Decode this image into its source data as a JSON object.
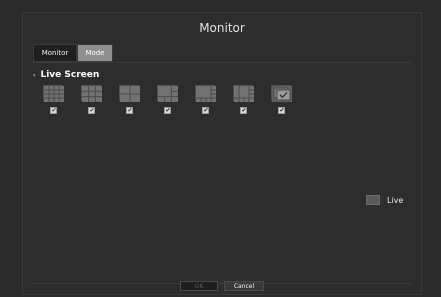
{
  "window": {
    "title": "Monitor"
  },
  "tabs": [
    {
      "label": "Monitor",
      "state": "normal"
    },
    {
      "label": "Mode",
      "state": "selected"
    }
  ],
  "section": {
    "title": "Live Screen"
  },
  "layouts": [
    {
      "icon": "grid-16",
      "checked": true,
      "enabled": false
    },
    {
      "icon": "grid-9",
      "checked": true,
      "enabled": false
    },
    {
      "icon": "grid-4",
      "checked": true,
      "enabled": false
    },
    {
      "icon": "grid-6a",
      "checked": true,
      "enabled": true
    },
    {
      "icon": "grid-6b",
      "checked": true,
      "enabled": true
    },
    {
      "icon": "grid-8",
      "checked": true,
      "enabled": true
    },
    {
      "icon": "sequence",
      "checked": true,
      "enabled": true
    }
  ],
  "live": {
    "label": "Live",
    "swatch_color": "#5a5a5a"
  },
  "footer": {
    "ok_label": "OK",
    "cancel_label": "Cancel"
  },
  "colors": {
    "background": "#2b2b2b",
    "selected_tab": "#8f8f8f"
  }
}
